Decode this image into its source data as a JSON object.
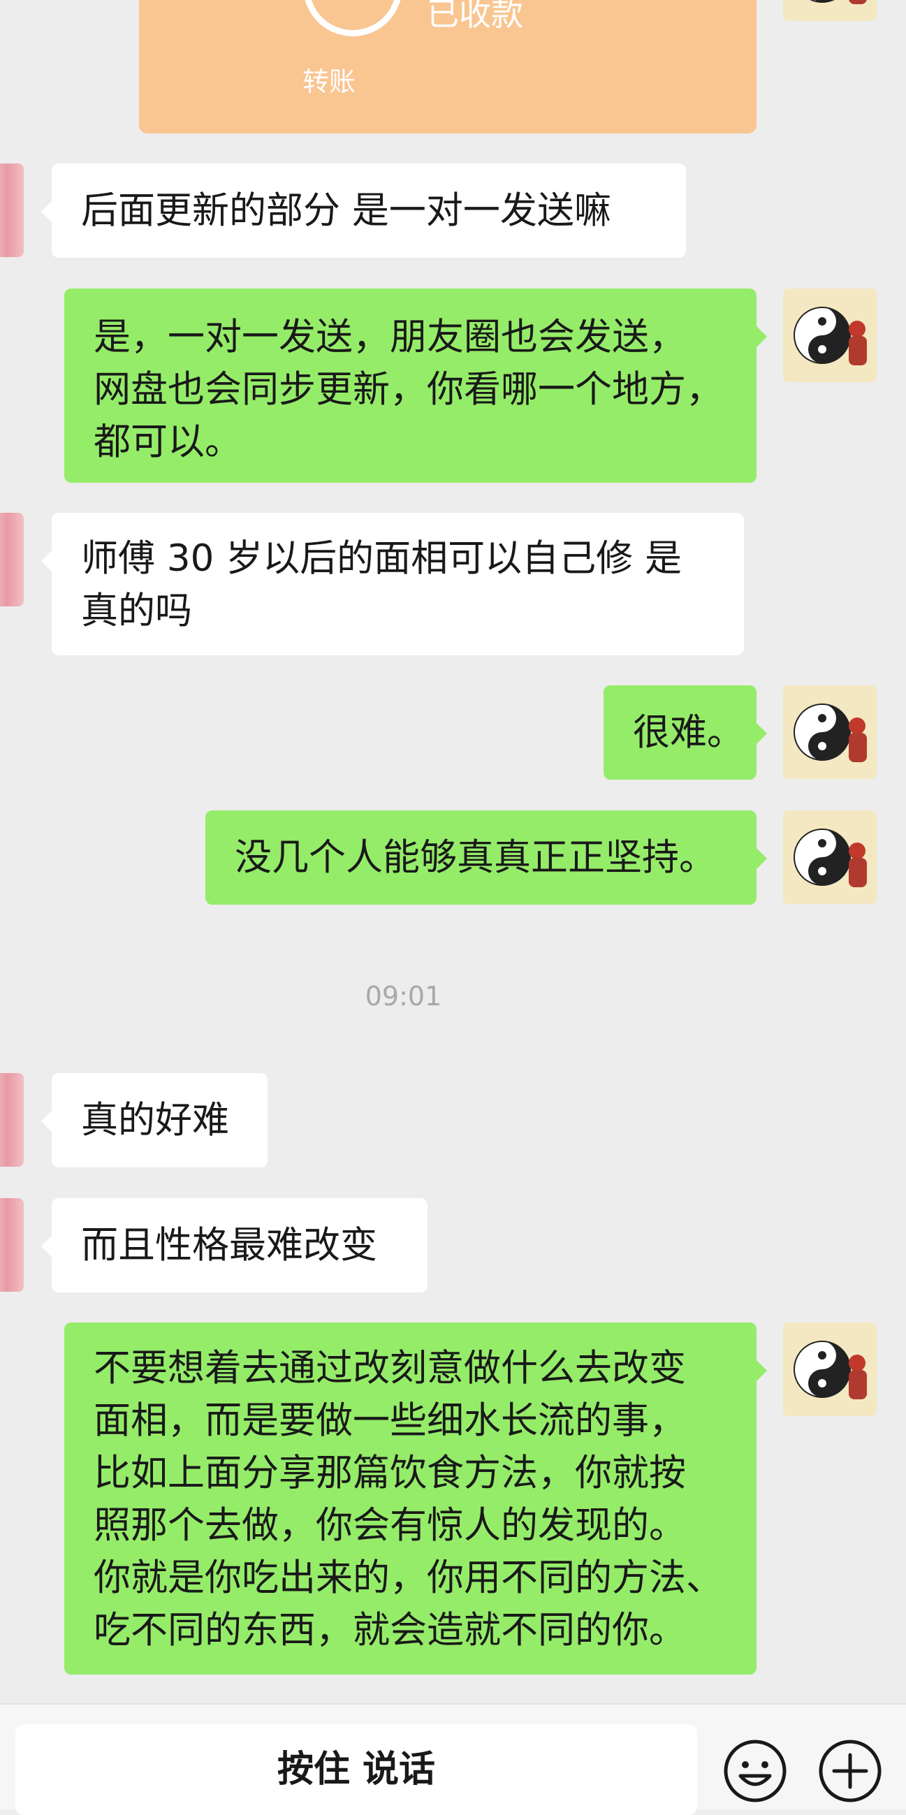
{
  "transfer": {
    "status": "已收款",
    "label": "转账"
  },
  "messages": [
    {
      "side": "left",
      "lines": [
        "后面更新的部分  是一对一发送嘛"
      ]
    },
    {
      "side": "right",
      "lines": [
        "是，一对一发送，朋友圈也会发送，",
        "网盘也会同步更新，你看哪一个地方，",
        "都可以。"
      ]
    },
    {
      "side": "left",
      "lines": [
        "师傅  30 岁以后的面相可以自己修  是",
        "真的吗"
      ]
    },
    {
      "side": "right",
      "lines": [
        "很难。"
      ]
    },
    {
      "side": "right",
      "lines": [
        "没几个人能够真真正正坚持。"
      ]
    },
    {
      "side": "left",
      "lines": [
        "真的好难"
      ]
    },
    {
      "side": "left",
      "lines": [
        "而且性格最难改变"
      ]
    },
    {
      "side": "right",
      "lines": [
        "不要想着去通过改刻意做什么去改变",
        "面相，而是要做一些细水长流的事，",
        "比如上面分享那篇饮食方法，你就按",
        "照那个去做，你会有惊人的发现的。",
        "你就是你吃出来的，你用不同的方法、",
        "吃不同的东西，就会造就不同的你。"
      ]
    }
  ],
  "timestamp": "09:01",
  "input_bar": {
    "hold_to_talk": "按住 说话",
    "emoji_icon": "smiley-icon",
    "more_icon": "plus-circle-icon"
  },
  "colors": {
    "background": "#ededed",
    "incoming_bubble": "#ffffff",
    "outgoing_bubble": "#95ec69",
    "transfer_card": "#f9c591"
  }
}
